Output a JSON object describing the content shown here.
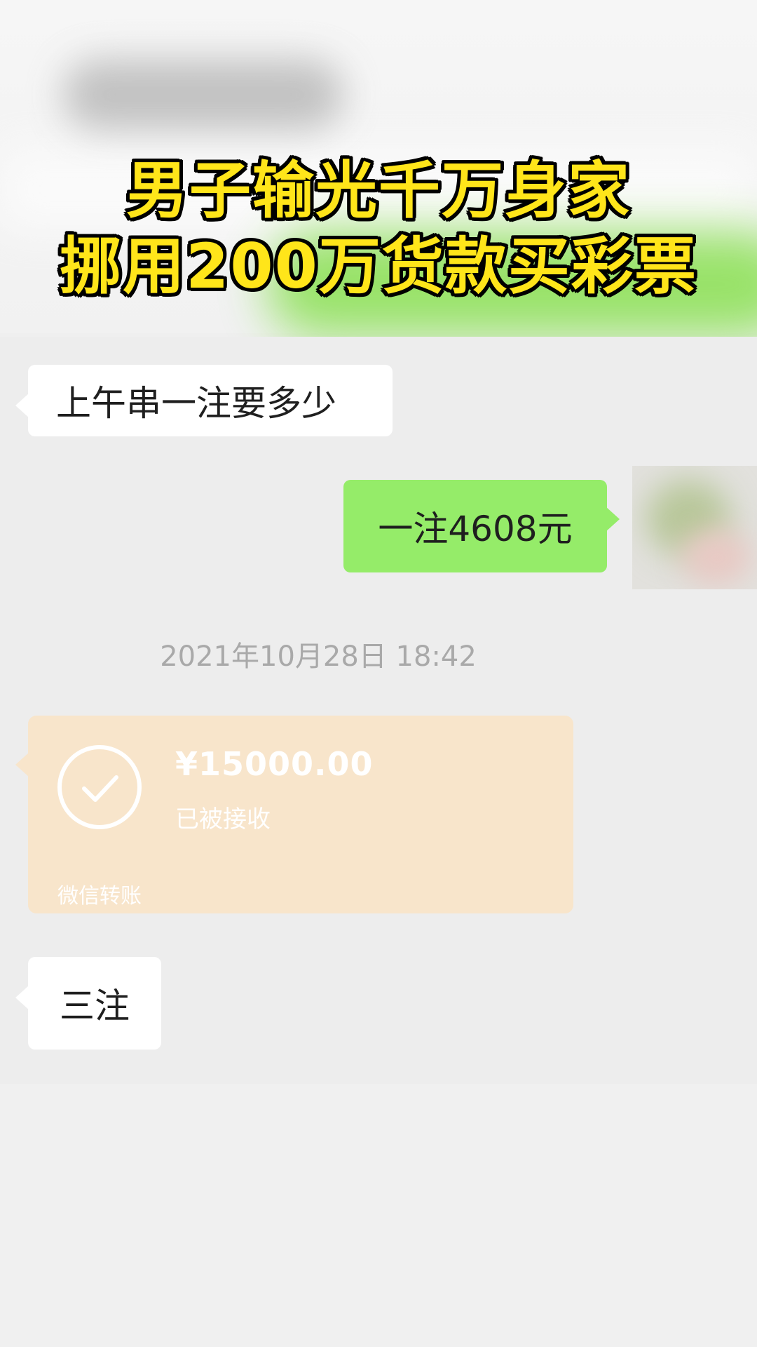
{
  "headline": {
    "line1": "男子输光千万身家",
    "line2": "挪用200万货款买彩票"
  },
  "messages": [
    {
      "side": "left",
      "text": "上午串一注要多少"
    },
    {
      "side": "right",
      "text": "一注4608元"
    }
  ],
  "timestamp": "2021年10月28日 18:42",
  "transfer": {
    "amount": "¥15000.00",
    "status": "已被接收",
    "footer": "微信转账"
  },
  "last_message": {
    "side": "left",
    "text": "三注"
  },
  "colors": {
    "headline_fill": "#ffe51a",
    "headline_outline": "#000000",
    "bubble_right": "#95ec69",
    "bubble_left": "#ffffff",
    "transfer_card": "#f8e5cb",
    "timestamp_text": "#a9a9a9"
  }
}
